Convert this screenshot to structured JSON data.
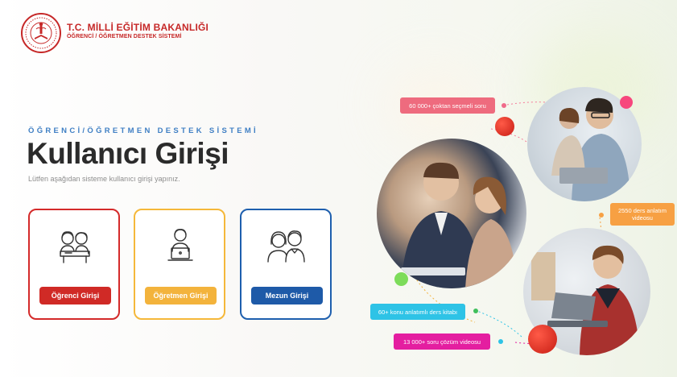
{
  "header": {
    "title": "T.C. MİLLİ EĞİTİM BAKANLIĞI",
    "subtitle": "ÖĞRENCİ / ÖĞRETMEN DESTEK SİSTEMİ"
  },
  "hero": {
    "eyebrow": "ÖĞRENCİ/ÖĞRETMEN DESTEK SİSTEMİ",
    "heading": "Kullanıcı Girişi",
    "description": "Lütfen aşağıdan sisteme kullanıcı girişi yapınız."
  },
  "login_cards": [
    {
      "label": "Öğrenci Girişi",
      "icon": "students-icon",
      "color": "#d02a26"
    },
    {
      "label": "Öğretmen Girişi",
      "icon": "teacher-laptop-icon",
      "color": "#f3b33c"
    },
    {
      "label": "Mezun Girişi",
      "icon": "graduates-icon",
      "color": "#1e5aa8"
    }
  ],
  "stats": {
    "questions": "60 000+ çoktan seçmeli soru",
    "lecture_videos": "2550 ders anlatım videosu",
    "books": "60+ konu anlatımlı ders kitabı",
    "solution_videos": "13 000+ soru çözüm videosu"
  },
  "colors": {
    "brand_red": "#c62828",
    "accent_blue": "#3f7fc4",
    "pill_pink": "#ee6b7e",
    "pill_orange": "#f7a043",
    "pill_cyan": "#2ec3e6",
    "pill_magenta": "#e41ea0"
  }
}
